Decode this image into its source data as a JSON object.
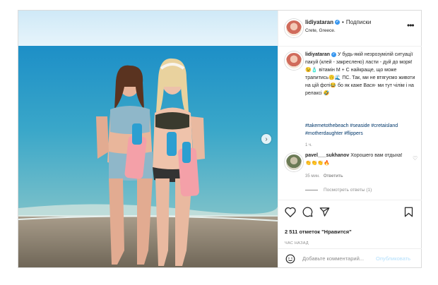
{
  "post": {
    "username": "lidiyataran",
    "follow_label": "Подписки",
    "location": "Crete, Greece.",
    "caption_text": "У будь-якій незрозумілій ситуації пакуй (клей - закреслено) ласти - дуй до моря!😉🧴 вітамін М + С найкраще, що може трапитись🙃🌊 ПС. Так, ми не втягуємо животи на цій фоті😂 бо як каже Вася- ми тут чілім і на релаксі 🤣",
    "hashtags": "#takemetothebeach #seaside #cretaisland #motherdaughter #flippers",
    "time": "1 ч.",
    "comment_user": "pavel___sukhanov",
    "comment_text": "Хорошего вам отдыха! 👏👏👏🔥",
    "comment_time": "35 мин.",
    "reply_label": "Ответить",
    "view_replies": "Посмотреть ответы (1)",
    "likes": "2 511 отметок \"Нравится\"",
    "posted_ago": "ЧАС НАЗАД",
    "add_comment_placeholder": "Добавьте комментарий...",
    "publish_label": "Опубликовать"
  },
  "icons": [
    "heart-icon",
    "comment-icon",
    "share-icon",
    "bookmark-icon",
    "emoji-icon",
    "more-icon",
    "verified-icon",
    "next-arrow-icon"
  ],
  "colors": {
    "link": "#00376b",
    "verified": "#3897f0",
    "publish": "#b2dffc",
    "muted": "#8e8e8e"
  }
}
